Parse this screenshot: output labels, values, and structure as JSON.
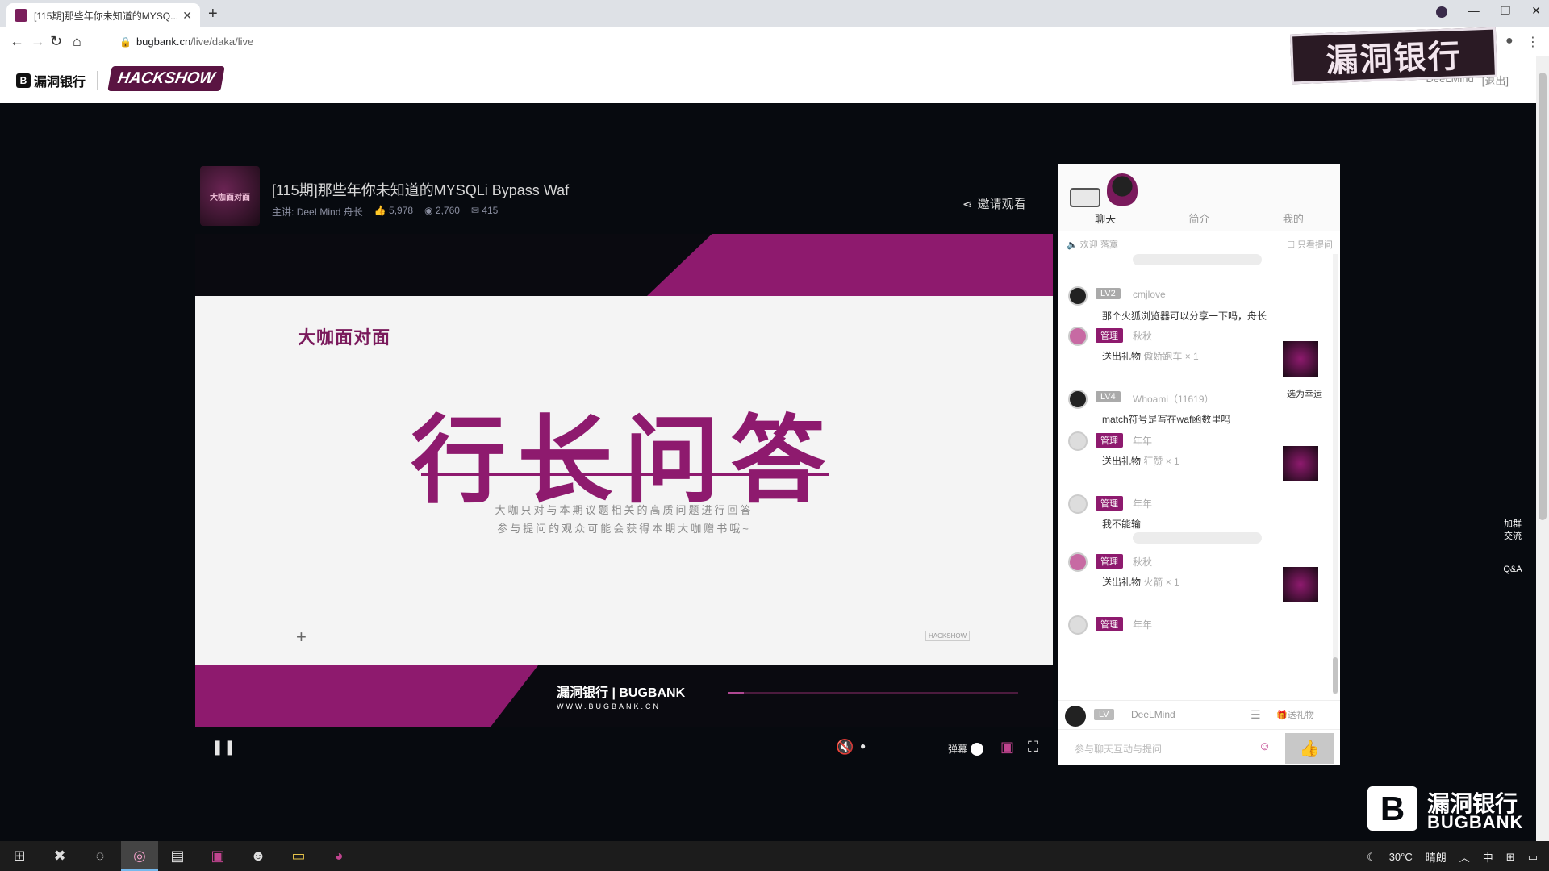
{
  "browser": {
    "tab_title": "[115期]那些年你未知道的MYSQ...",
    "url_domain": "bugbank.cn",
    "url_path": "/live/daka/live"
  },
  "site": {
    "logo_text": "漏洞银行",
    "show_logo": "HACKSHOW",
    "overlay_logo": "漏洞银行",
    "user_name": "DeeLMind",
    "logout": "[退出]"
  },
  "room": {
    "title": "[115期]那些年你未知道的MYSQLi Bypass Waf",
    "host_label": "主讲:",
    "host": "DeeLMind 舟长",
    "likes": "5,978",
    "views": "2,760",
    "comments": "415",
    "invite": "邀请观看",
    "avatar_text": "大咖面对面"
  },
  "slide": {
    "badge": "大咖面对面",
    "title": "行长问答",
    "sub1": "大咖只对与本期议题相关的高质问题进行回答",
    "sub2": "参与提问的观众可能会获得本期大咖赠书哦~",
    "watermark": "HACKSHOW",
    "brand_cn": "漏洞银行 | BUGBANK",
    "brand_en": "WWW.BUGBANK.CN"
  },
  "player": {
    "danmu_label": "弹幕"
  },
  "chat": {
    "tabs": [
      "聊天",
      "简介",
      "我的"
    ],
    "welcome": "欢迎",
    "welcome_name": "落寞",
    "only_questions": "只看提问",
    "messages": [
      {
        "badge": "LV2",
        "name": "cmjlove",
        "text": "那个火狐浏览器可以分享一下吗，舟长"
      },
      {
        "badge": "管理",
        "name": "秋秋",
        "text": "送出礼物",
        "gift": "傲娇跑车 × 1"
      },
      {
        "badge": "LV4",
        "name": "Whoami（11619）",
        "text": "match符号是写在waf函数里吗"
      },
      {
        "badge": "管理",
        "name": "年年",
        "text": "送出礼物",
        "gift": "狂赞 × 1"
      },
      {
        "badge": "管理",
        "name": "年年",
        "text": "我不能输"
      },
      {
        "badge": "管理",
        "name": "秋秋",
        "text": "送出礼物",
        "gift": "火箭 × 1"
      },
      {
        "badge": "管理",
        "name": "年年",
        "text": ""
      }
    ],
    "lucky": "选为幸运",
    "me_name": "DeeLMind",
    "send_gift": "送礼物",
    "input_placeholder": "参与聊天互动与提问"
  },
  "side": {
    "group": "加群交流",
    "qa": "Q&A"
  },
  "brand_corner": {
    "cn": "漏洞银行",
    "en": "BUGBANK"
  },
  "tray": {
    "temp": "30°C",
    "weather": "晴朗",
    "ime": "中"
  }
}
